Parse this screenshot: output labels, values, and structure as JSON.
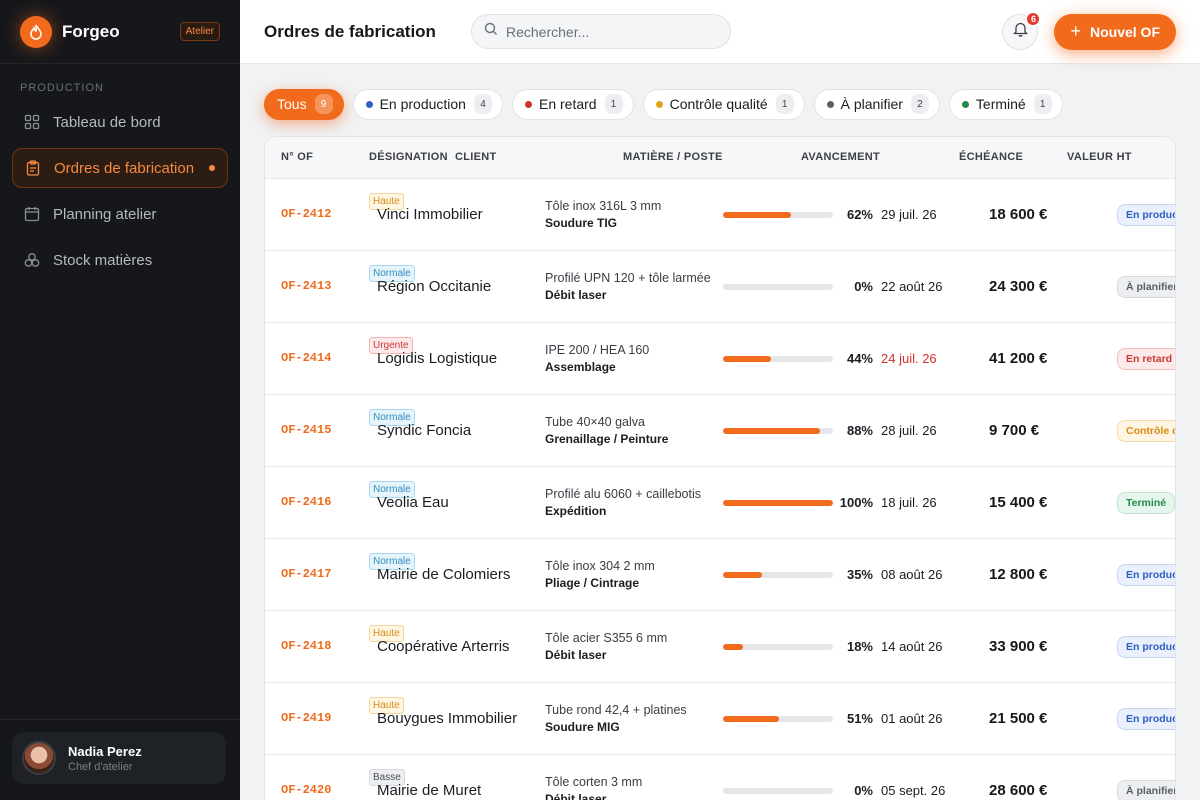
{
  "sidebar": {
    "brand": "Forgeo",
    "badge": "Atelier",
    "section": "PRODUCTION",
    "items": [
      {
        "label": "Tableau de bord",
        "icon": "grid-icon"
      },
      {
        "label": "Ordres de fabrication",
        "icon": "clipboard-icon",
        "active": true
      },
      {
        "label": "Planning atelier",
        "icon": "calendar-icon"
      },
      {
        "label": "Stock matières",
        "icon": "boxes-icon"
      }
    ],
    "user": {
      "name": "Nadia Perez",
      "role": "Chef d'atelier"
    }
  },
  "topbar": {
    "title": "Ordres de fabrication",
    "search_placeholder": "Rechercher...",
    "notifications": "6",
    "new_button": "Nouvel OF"
  },
  "filters": [
    {
      "label": "Tous",
      "count": "9",
      "active": true
    },
    {
      "label": "En production",
      "count": "4",
      "color": "#2d5fc4"
    },
    {
      "label": "En retard",
      "count": "1",
      "color": "#d2322c"
    },
    {
      "label": "Contrôle qualité",
      "count": "1",
      "color": "#e0a21a"
    },
    {
      "label": "À planifier",
      "count": "2",
      "color": "#5a5e66"
    },
    {
      "label": "Terminé",
      "count": "1",
      "color": "#24894a"
    }
  ],
  "table": {
    "headers": {
      "num": "N° OF",
      "designation": "DÉSIGNATION",
      "client": "CLIENT",
      "matiere": "MATIÈRE / POSTE",
      "avancement": "AVANCEMENT",
      "echeance": "ÉCHÉANCE",
      "valeur": "VALEUR HT"
    },
    "rows": [
      {
        "num": "OF-2412",
        "priority": "Haute",
        "client": "Vinci Immobilier",
        "matiere": "Tôle inox 316L 3 mm",
        "poste": "Soudure TIG",
        "progress": 62,
        "pct": "62%",
        "date": "29 juil. 26",
        "late": false,
        "value": "18 600 €",
        "status": "En production"
      },
      {
        "num": "OF-2413",
        "priority": "Normale",
        "client": "Région Occitanie",
        "matiere": "Profilé UPN 120 + tôle larmée",
        "poste": "Débit laser",
        "progress": 0,
        "pct": "0%",
        "date": "22 août 26",
        "late": false,
        "value": "24 300 €",
        "status": "À planifier"
      },
      {
        "num": "OF-2414",
        "priority": "Urgente",
        "client": "Logidis Logistique",
        "matiere": "IPE 200 / HEA 160",
        "poste": "Assemblage",
        "progress": 44,
        "pct": "44%",
        "date": "24 juil. 26",
        "late": true,
        "value": "41 200 €",
        "status": "En retard"
      },
      {
        "num": "OF-2415",
        "priority": "Normale",
        "client": "Syndic Foncia",
        "matiere": "Tube 40×40 galva",
        "poste": "Grenaillage / Peinture",
        "progress": 88,
        "pct": "88%",
        "date": "28 juil. 26",
        "late": false,
        "value": "9 700 €",
        "status": "Contrôle qualité"
      },
      {
        "num": "OF-2416",
        "priority": "Normale",
        "client": "Veolia Eau",
        "matiere": "Profilé alu 6060 + caillebotis",
        "poste": "Expédition",
        "progress": 100,
        "pct": "100%",
        "date": "18 juil. 26",
        "late": false,
        "value": "15 400 €",
        "status": "Terminé"
      },
      {
        "num": "OF-2417",
        "priority": "Normale",
        "client": "Mairie de Colomiers",
        "matiere": "Tôle inox 304 2 mm",
        "poste": "Pliage / Cintrage",
        "progress": 35,
        "pct": "35%",
        "date": "08 août 26",
        "late": false,
        "value": "12 800 €",
        "status": "En production"
      },
      {
        "num": "OF-2418",
        "priority": "Haute",
        "client": "Coopérative Arterris",
        "matiere": "Tôle acier S355 6 mm",
        "poste": "Débit laser",
        "progress": 18,
        "pct": "18%",
        "date": "14 août 26",
        "late": false,
        "value": "33 900 €",
        "status": "En production"
      },
      {
        "num": "OF-2419",
        "priority": "Haute",
        "client": "Bouygues Immobilier",
        "matiere": "Tube rond 42,4 + platines",
        "poste": "Soudure MIG",
        "progress": 51,
        "pct": "51%",
        "date": "01 août 26",
        "late": false,
        "value": "21 500 €",
        "status": "En production"
      },
      {
        "num": "OF-2420",
        "priority": "Basse",
        "client": "Mairie de Muret",
        "matiere": "Tôle corten 3 mm",
        "poste": "Débit laser",
        "progress": 0,
        "pct": "0%",
        "date": "05 sept. 26",
        "late": false,
        "value": "28 600 €",
        "status": "À planifier"
      }
    ]
  }
}
